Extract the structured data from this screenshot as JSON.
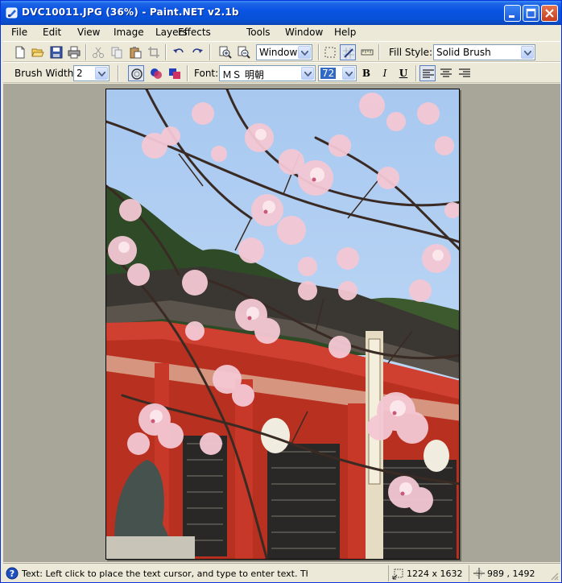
{
  "window": {
    "title": "DVC10011.JPG (36%) - Paint.NET v2.1b"
  },
  "menu": [
    "File",
    "Edit",
    "View",
    "Image",
    "Layers",
    "Effects",
    "Tools",
    "Window",
    "Help"
  ],
  "toolbar1": {
    "zoom_value": "Window",
    "fill_style_label": "Fill Style:",
    "fill_style_value": "Solid Brush"
  },
  "toolbar2": {
    "brush_width_label": "Brush Width:",
    "brush_width_value": "2",
    "font_label": "Font:",
    "font_name": "ＭＳ 明朝",
    "font_size": "72",
    "bold": "B",
    "italic": "I",
    "underline": "U"
  },
  "status": {
    "help_text": "Text: Left click to place the text cursor, and type to enter text. The t",
    "image_size": "1224 x 1632",
    "cursor_position": "989 , 1492"
  },
  "colors": {
    "titlebar": "#0a54e3",
    "workspace": "#a8a698",
    "chrome": "#ece9d8"
  }
}
